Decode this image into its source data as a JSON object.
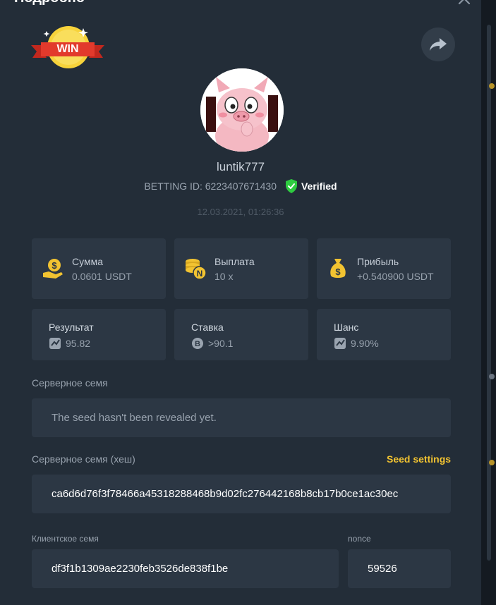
{
  "modal": {
    "title": "Подробно"
  },
  "logo": {
    "text": "WIN"
  },
  "user": {
    "name": "luntik777",
    "betting_id": "BETTING ID: 6223407671430",
    "verified": "Verified",
    "timestamp": "12.03.2021, 01:26:36"
  },
  "stats": [
    {
      "label": "Сумма",
      "value": "0.0601 USDT",
      "icon": "coin-hand-icon"
    },
    {
      "label": "Выплата",
      "value": "10 x",
      "icon": "coin-stack-icon"
    },
    {
      "label": "Прибыль",
      "value": "+0.540900 USDT",
      "icon": "money-bag-icon"
    }
  ],
  "details": [
    {
      "label": "Результат",
      "value": "95.82",
      "icon": "dice-icon"
    },
    {
      "label": "Ставка",
      "value": ">90.1",
      "icon": "bitcoin-icon"
    },
    {
      "label": "Шанс",
      "value": "9.90%",
      "icon": "dice-icon"
    }
  ],
  "server_seed": {
    "label": "Серверное семя",
    "value": "The seed hasn't been revealed yet."
  },
  "server_seed_hash": {
    "label": "Серверное семя (хеш)",
    "link": "Seed settings",
    "value": "ca6d6d76f3f78466a45318288468b9d02fc276442168b8cb17b0ce1ac30ec"
  },
  "client_seed": {
    "label": "Клиентское семя",
    "value": "df3f1b1309ae2230feb3526de838f1be"
  },
  "nonce": {
    "label": "nonce",
    "value": "59526"
  },
  "colors": {
    "background": "#232d38",
    "card": "#2c3744",
    "accent": "#f2c331",
    "verified": "#2ecc40"
  }
}
